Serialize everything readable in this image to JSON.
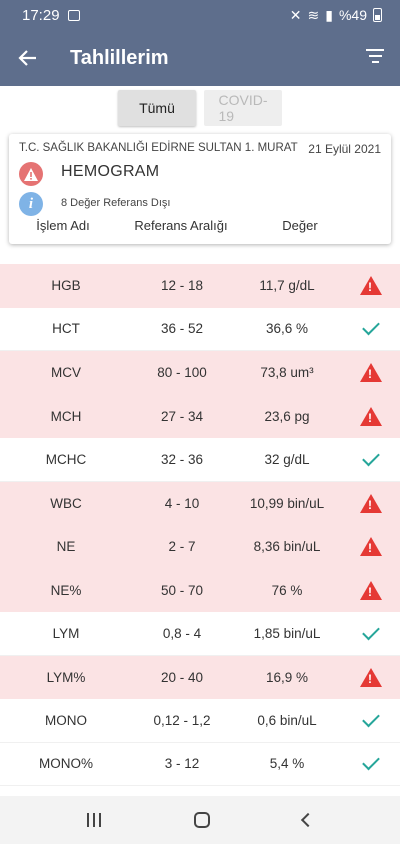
{
  "status_bar": {
    "time": "17:29",
    "battery": "%49"
  },
  "app_bar": {
    "title": "Tahlillerim"
  },
  "tabs": [
    {
      "label": "Tümü"
    },
    {
      "label": "COVID-19"
    }
  ],
  "card": {
    "hospital": "T.C. SAĞLIK BAKANLIĞI EDİRNE SULTAN 1. MURAT",
    "date": "21 Eylül 2021",
    "test_name": "HEMOGRAM",
    "note": "8 Değer Referans Dışı",
    "columns": {
      "name": "İşlem Adı",
      "range": "Referans Aralığı",
      "value": "Değer"
    }
  },
  "rows": [
    {
      "name": "HGB",
      "range": "12 - 18",
      "value": "11,7 g/dL",
      "status": "abnormal"
    },
    {
      "name": "HCT",
      "range": "36 - 52",
      "value": "36,6 %",
      "status": "normal"
    },
    {
      "name": "MCV",
      "range": "80 - 100",
      "value": "73,8 um³",
      "status": "abnormal"
    },
    {
      "name": "MCH",
      "range": "27 - 34",
      "value": "23,6 pg",
      "status": "abnormal"
    },
    {
      "name": "MCHC",
      "range": "32 - 36",
      "value": "32 g/dL",
      "status": "normal"
    },
    {
      "name": "WBC",
      "range": "4 - 10",
      "value": "10,99 bin/uL",
      "status": "abnormal"
    },
    {
      "name": "NE",
      "range": "2 - 7",
      "value": "8,36 bin/uL",
      "status": "abnormal"
    },
    {
      "name": "NE%",
      "range": "50 - 70",
      "value": "76 %",
      "status": "abnormal"
    },
    {
      "name": "LYM",
      "range": "0,8 - 4",
      "value": "1,85 bin/uL",
      "status": "normal"
    },
    {
      "name": "LYM%",
      "range": "20 - 40",
      "value": "16,9 %",
      "status": "abnormal"
    },
    {
      "name": "MONO",
      "range": "0,12 - 1,2",
      "value": "0,6 bin/uL",
      "status": "normal"
    },
    {
      "name": "MONO%",
      "range": "3 - 12",
      "value": "5,4 %",
      "status": "normal"
    }
  ],
  "colors": {
    "app_bar": "#5e6e8c",
    "abnormal_row": "#fbe3e4",
    "warning": "#e53935",
    "ok": "#26a69a",
    "info": "#7fb3e6"
  },
  "icons": {
    "back": "arrow-left-icon",
    "filter": "filter-icon",
    "warning": "warning-triangle-icon",
    "info": "info-icon",
    "ok": "check-icon"
  }
}
